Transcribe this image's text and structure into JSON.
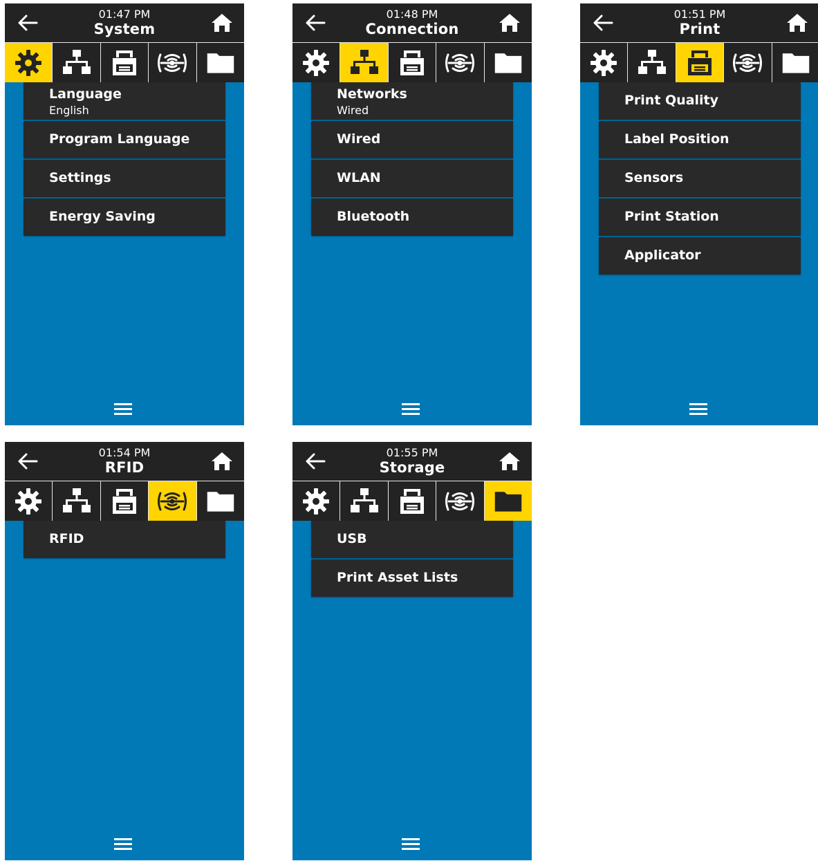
{
  "colors": {
    "screen_bg": "#0079b6",
    "header_bg": "#232323",
    "tab_active": "#ffd400",
    "menu_item_bg": "#292929",
    "text": "#ffffff"
  },
  "icons": {
    "back": "arrow-left-icon",
    "home": "home-icon",
    "tabs": [
      "gear-icon",
      "network-icon",
      "printer-icon",
      "rfid-icon",
      "folder-icon"
    ],
    "menu": "hamburger-menu-icon"
  },
  "screens": [
    {
      "time": "01:47 PM",
      "title": "System",
      "active_tab": 0,
      "items": [
        {
          "label": "Language",
          "value": "English"
        },
        {
          "label": "Program Language"
        },
        {
          "label": "Settings"
        },
        {
          "label": "Energy Saving"
        }
      ]
    },
    {
      "time": "01:48 PM",
      "title": "Connection",
      "active_tab": 1,
      "items": [
        {
          "label": "Networks",
          "value": "Wired"
        },
        {
          "label": "Wired"
        },
        {
          "label": "WLAN"
        },
        {
          "label": "Bluetooth"
        }
      ]
    },
    {
      "time": "01:51 PM",
      "title": "Print",
      "active_tab": 2,
      "items": [
        {
          "label": "Print Quality"
        },
        {
          "label": "Label Position"
        },
        {
          "label": "Sensors"
        },
        {
          "label": "Print Station"
        },
        {
          "label": "Applicator"
        }
      ]
    },
    {
      "time": "01:54 PM",
      "title": "RFID",
      "active_tab": 3,
      "items": [
        {
          "label": "RFID"
        }
      ]
    },
    {
      "time": "01:55 PM",
      "title": "Storage",
      "active_tab": 4,
      "items": [
        {
          "label": "USB"
        },
        {
          "label": "Print Asset Lists"
        }
      ]
    }
  ]
}
